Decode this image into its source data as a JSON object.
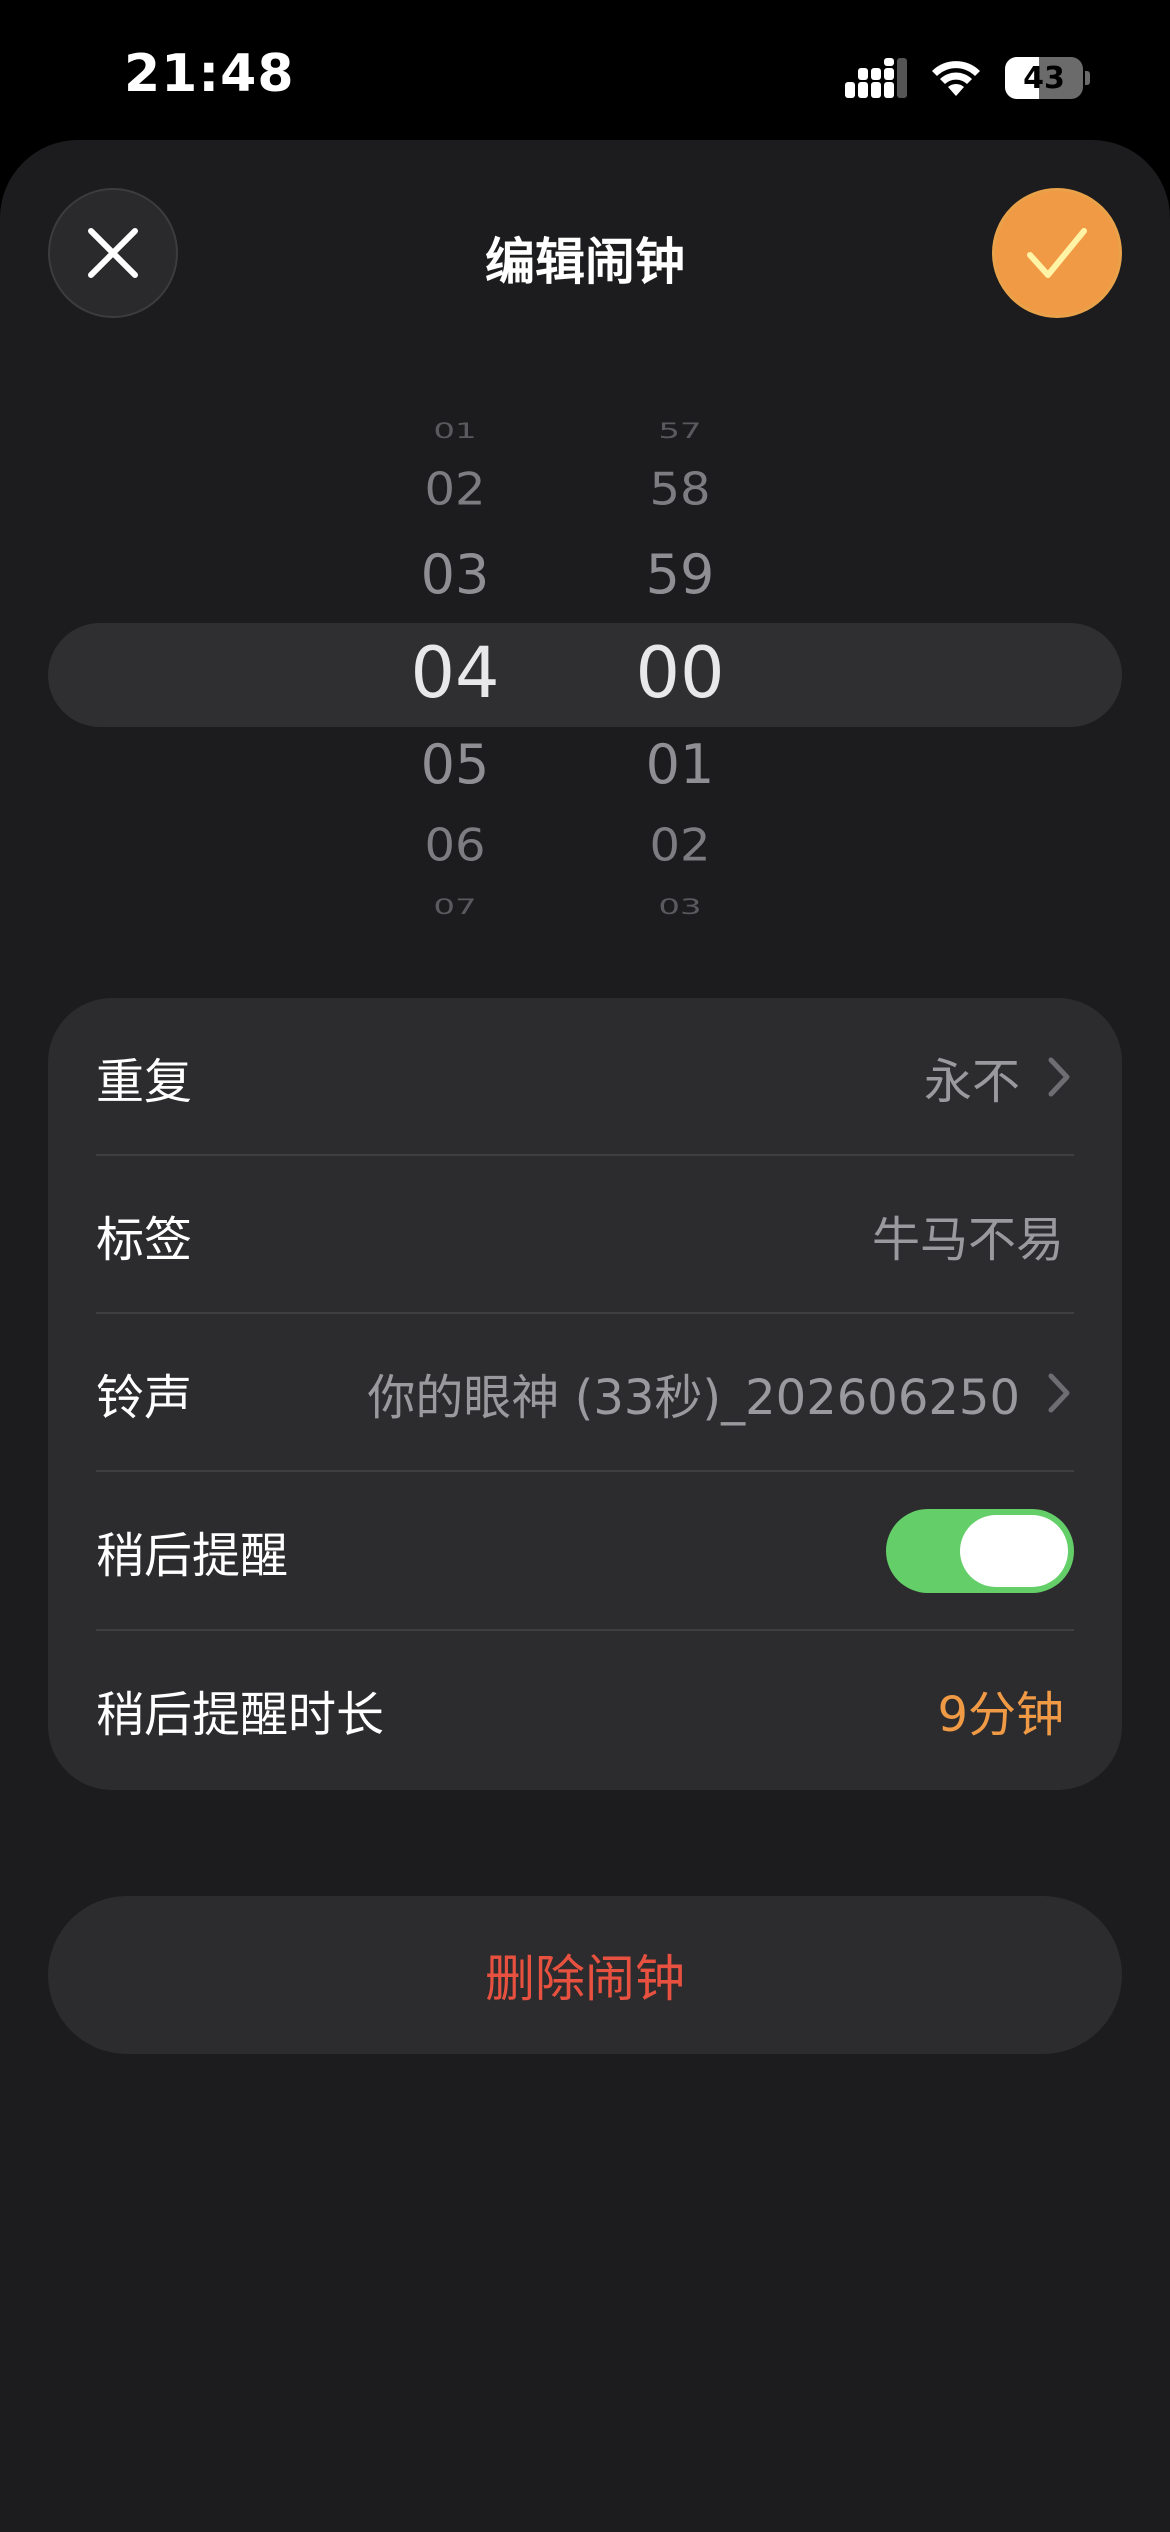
{
  "status": {
    "time": "21:48",
    "battery": "43",
    "battery_level_percent": 43
  },
  "header": {
    "title": "编辑闹钟",
    "close_icon": "close-icon",
    "confirm_icon": "checkmark-icon"
  },
  "colors": {
    "accent": "#f09a45",
    "toggle_on": "#64cf68",
    "destructive": "#e8513f",
    "card": "#2c2c2e",
    "sheet": "#1c1c1e"
  },
  "picker": {
    "hours": [
      "01",
      "02",
      "03",
      "04",
      "05",
      "06",
      "07"
    ],
    "minutes": [
      "57",
      "58",
      "59",
      "00",
      "01",
      "02",
      "03"
    ],
    "selected_hour": "04",
    "selected_minute": "00"
  },
  "settings": {
    "repeat": {
      "label": "重复",
      "value": "永不"
    },
    "label": {
      "label": "标签",
      "value": "牛马不易"
    },
    "sound": {
      "label": "铃声",
      "value": "你的眼神 (33秒)_202606250"
    },
    "snooze": {
      "label": "稍后提醒",
      "enabled": true
    },
    "snooze_duration": {
      "label": "稍后提醒时长",
      "value": "9分钟"
    }
  },
  "actions": {
    "delete_label": "删除闹钟"
  }
}
